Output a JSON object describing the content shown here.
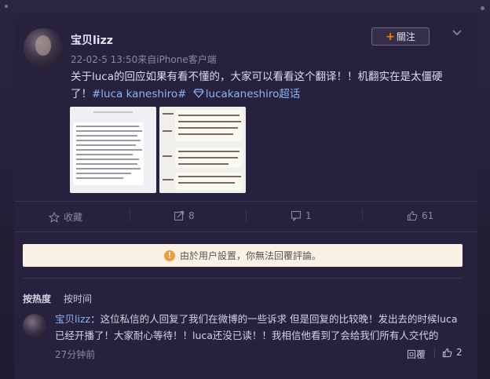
{
  "post": {
    "username": "宝贝lizz",
    "meta": "22-02-5 13:50来自iPhone客户端",
    "follow_label": "關注",
    "text_line1": "关于luca的回应如果有看不懂的，大家可以看看这个翻译！！机翻实在是太僵硬",
    "text_line2_prefix": "了！",
    "hashtag": "#luca kaneshiro#",
    "supertopic": "lucakaneshiro超话"
  },
  "thumbnails": [
    {
      "kind": "english-chat-screenshot"
    },
    {
      "kind": "chinese-translation-screenshot"
    }
  ],
  "actions": {
    "favorite_label": "收藏",
    "repost_count": "8",
    "comment_count": "1",
    "like_count": "61"
  },
  "notice": {
    "text": "由於用户設置，你無法回覆評論。"
  },
  "comments_sort": {
    "hot_label": "按热度",
    "time_label": "按时间"
  },
  "comment": {
    "username": "宝贝lizz",
    "text": "：这位私信的人回复了我们在微博的一些诉求 但是回复的比较晚！发出去的时候luca已经开播了！大家耐心等待！！luca还没已读！！我相信他看到了会给我们所有人交代的",
    "time": "27分钟前",
    "reply_label": "回覆",
    "like_count": "2"
  },
  "colors": {
    "accent_orange": "#ff8200",
    "link_blue": "#8ab4f8",
    "notice_bg": "#fbf0e4"
  }
}
